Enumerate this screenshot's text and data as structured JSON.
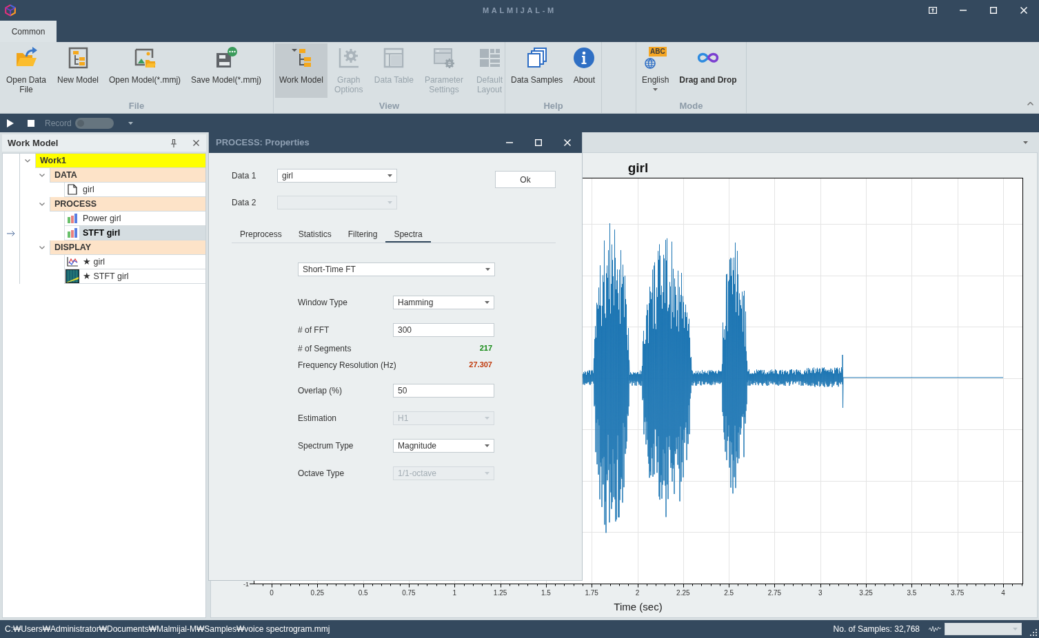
{
  "window": {
    "title": "MALMIJAL-M"
  },
  "ribbon_tabs": [
    {
      "label": "Common",
      "selected": true
    }
  ],
  "ribbon_groups": [
    {
      "label": "File",
      "buttons": [
        {
          "label": "Open Data File",
          "kind": "button",
          "disabled": false,
          "pressed": false,
          "active": false
        },
        {
          "label": "New Model",
          "kind": "button",
          "disabled": false,
          "pressed": false,
          "active": false
        },
        {
          "label": "Open Model(*.mmj)",
          "kind": "button",
          "disabled": false,
          "pressed": false,
          "active": false
        },
        {
          "label": "Save Model(*.mmj)",
          "kind": "button",
          "disabled": false,
          "pressed": false,
          "active": false
        }
      ]
    },
    {
      "label": "View",
      "buttons": [
        {
          "label": "Work Model",
          "kind": "button",
          "disabled": false,
          "pressed": true,
          "active": false
        },
        {
          "label": "Graph Options",
          "kind": "button",
          "disabled": true,
          "pressed": false,
          "active": false
        },
        {
          "label": "Data Table",
          "kind": "button",
          "disabled": true,
          "pressed": false,
          "active": false
        },
        {
          "label": "Parameter Settings",
          "kind": "button",
          "disabled": true,
          "pressed": false,
          "active": false
        },
        {
          "label": "Default Layout",
          "kind": "button",
          "disabled": true,
          "pressed": false,
          "active": false
        }
      ]
    },
    {
      "label": "Help",
      "buttons": [
        {
          "label": "Data Samples",
          "kind": "button",
          "disabled": false,
          "pressed": false,
          "active": false
        },
        {
          "label": "About",
          "kind": "button",
          "disabled": false,
          "pressed": false,
          "active": false
        }
      ]
    },
    {
      "label": "Mode",
      "buttons": [
        {
          "label": "English",
          "kind": "dropdown",
          "tag": "ABC",
          "disabled": false,
          "pressed": false,
          "active": false
        },
        {
          "label": "Drag and Drop",
          "kind": "button",
          "disabled": false,
          "pressed": false,
          "active": true
        }
      ]
    }
  ],
  "toolbar": {
    "record": {
      "label": "Record",
      "on": false
    }
  },
  "work_model_panel": {
    "title": "Work Model",
    "tree": [
      {
        "label": "Work1",
        "kind": "root",
        "expanded": true,
        "selected": false,
        "children": [
          {
            "label": "DATA",
            "kind": "group",
            "expanded": true,
            "selected": false,
            "children": [
              {
                "label": "girl",
                "kind": "data",
                "selected": false
              }
            ]
          },
          {
            "label": "PROCESS",
            "kind": "group",
            "expanded": true,
            "selected": false,
            "children": [
              {
                "label": "Power girl",
                "kind": "process",
                "selected": false
              },
              {
                "label": "STFT girl",
                "kind": "process",
                "selected": true
              }
            ]
          },
          {
            "label": "DISPLAY",
            "kind": "group",
            "expanded": true,
            "selected": false,
            "children": [
              {
                "label": "★ girl",
                "kind": "plot",
                "selected": false
              },
              {
                "label": "★ STFT girl",
                "kind": "spectrogram",
                "selected": false
              }
            ]
          }
        ]
      }
    ]
  },
  "properties_dialog": {
    "title": "PROCESS: Properties",
    "data_fields": [
      {
        "label": "Data 1",
        "value": "girl",
        "disabled": false
      },
      {
        "label": "Data 2",
        "disabled": true
      }
    ],
    "ok_button": "Ok",
    "tabs": [
      {
        "label": "Preprocess",
        "selected": false
      },
      {
        "label": "Statistics",
        "selected": false
      },
      {
        "label": "Filtering",
        "selected": false
      },
      {
        "label": "Spectra",
        "selected": true
      }
    ],
    "method": {
      "value": "Short-Time FT",
      "disabled": false
    },
    "rows": [
      {
        "kind": "dropdown",
        "label": "Window Type",
        "value": "Hamming",
        "disabled": false
      },
      {
        "kind": "input",
        "label": "# of FFT",
        "value": "300",
        "disabled": false
      },
      {
        "kind": "readout",
        "label": "# of Segments",
        "value": "217",
        "color": "#138a13",
        "disabled": false
      },
      {
        "kind": "readout",
        "label": "Frequency Resolution (Hz)",
        "value": "27.307",
        "color": "#c0390b",
        "disabled": false
      },
      {
        "kind": "input",
        "label": "Overlap (%)",
        "value": "50",
        "disabled": false
      },
      {
        "kind": "dropdown",
        "label": "Estimation",
        "value": "H1",
        "disabled": true
      },
      {
        "kind": "dropdown",
        "label": "Spectrum Type",
        "value": "Magnitude",
        "disabled": false
      },
      {
        "kind": "dropdown",
        "label": "Octave Type",
        "value": "1/1-octave",
        "disabled": true
      }
    ]
  },
  "document": {
    "plot": {
      "title": "girl",
      "xlabel": "Time (sec)",
      "xticks": [
        "0",
        "0.25",
        "0.5",
        "0.75",
        "1",
        "1.25",
        "1.5",
        "1.75",
        "2",
        "2.25",
        "2.5",
        "2.75",
        "3",
        "3.25",
        "3.5",
        "3.75",
        "4"
      ],
      "yticks": [
        "-1"
      ]
    }
  },
  "status_bar": {
    "path": "C:₩Users₩Administrator₩Documents₩Malmijal-M₩Samples₩voice spectrogram.mmj",
    "samples": "No. of Samples: 32,768",
    "selector": {
      "disabled": true
    }
  }
}
